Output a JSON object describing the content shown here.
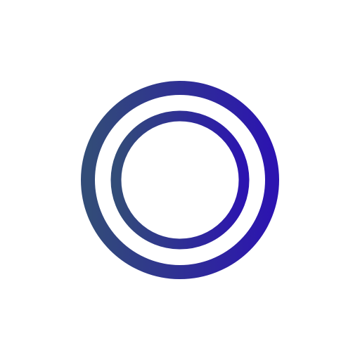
{
  "icon": {
    "name": "concentric-rings-icon",
    "description_visible_text": "",
    "colors": {
      "background": "#ffffff",
      "gradient_start": "#324c78",
      "gradient_end": "#2c14b0"
    }
  }
}
